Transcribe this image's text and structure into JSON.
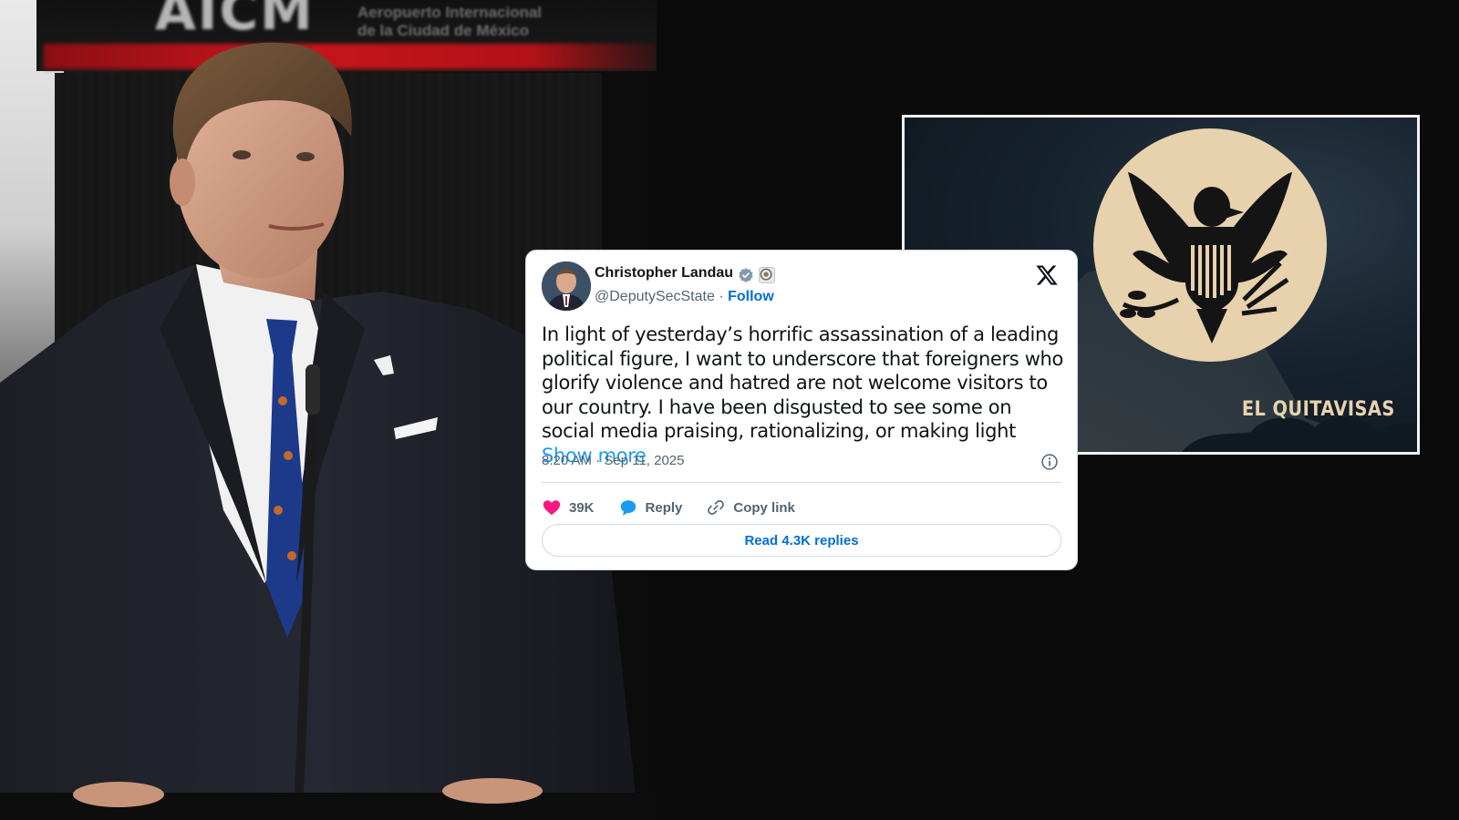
{
  "photo": {
    "banner_text": "AICM",
    "banner_small_1": "Aeropuerto Internacional",
    "banner_small_2": "de la Ciudad de México"
  },
  "eagle_image": {
    "brand": "EL QUITAVISAS"
  },
  "tweet": {
    "author_name": "Christopher Landau",
    "handle": "@DeputySecState",
    "separator": "·",
    "follow_label": "Follow",
    "text": "In light of yesterday’s horrific assassination of a leading political figure, I want to underscore that foreigners who glorify violence and hatred are not welcome visitors to our country. I have been disgusted to see some on social media praising, rationalizing, or making light",
    "show_more_label": "Show more",
    "timestamp": "8:20 AM · Sep 11, 2025",
    "like_count": "39K",
    "reply_label": "Reply",
    "copy_link_label": "Copy link",
    "read_replies_label": "Read 4.3K replies"
  },
  "colors": {
    "link_blue": "#006fd6",
    "like_pink": "#f91880",
    "reply_blue": "#1d9bf0",
    "brand_beige": "#e7d3b0"
  }
}
